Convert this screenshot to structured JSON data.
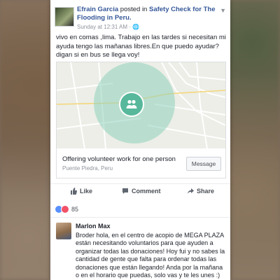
{
  "colors": {
    "link": "#365899",
    "safety_green": "#57b89b",
    "text": "#1d2129",
    "muted": "#90949c",
    "like_blue": "#5890ff",
    "love_red": "#f25268"
  },
  "post": {
    "author": "Efrain Garcia",
    "posted_in_text": "posted in",
    "group": "Safety Check for The Flooding in Peru.",
    "timestamp": "Sunday at 12:31 AM",
    "menu_icon": "chevron-down-icon",
    "body": "vivo en comas ,lima. Trabajo en las tardes  si necesitan mi ayuda tengo las mañanas libres.En que puedo ayudar?digan si en bus se llega voy!"
  },
  "offer": {
    "title": "Offering volunteer work for one person",
    "location": "Puente Piedra, Peru",
    "message_button": "Message",
    "marker_icon": "people-icon"
  },
  "actions": {
    "like": "Like",
    "comment": "Comment",
    "share": "Share"
  },
  "reactions": {
    "count": "85",
    "icons": [
      "like-icon",
      "love-icon"
    ]
  },
  "comment": {
    "author": "Marlon Max",
    "text": "Broder hola, en el centro de acopio de MEGA PLAZA están necesitando voluntarios para que ayuden a organizar todas las donaciones! Hoy fui y no sabes la cantidad de gente que falta para ordenar todas las donaciones que están llegando! Anda por la mañana o en el horario que puedas, solo vas y te les unes :)"
  }
}
